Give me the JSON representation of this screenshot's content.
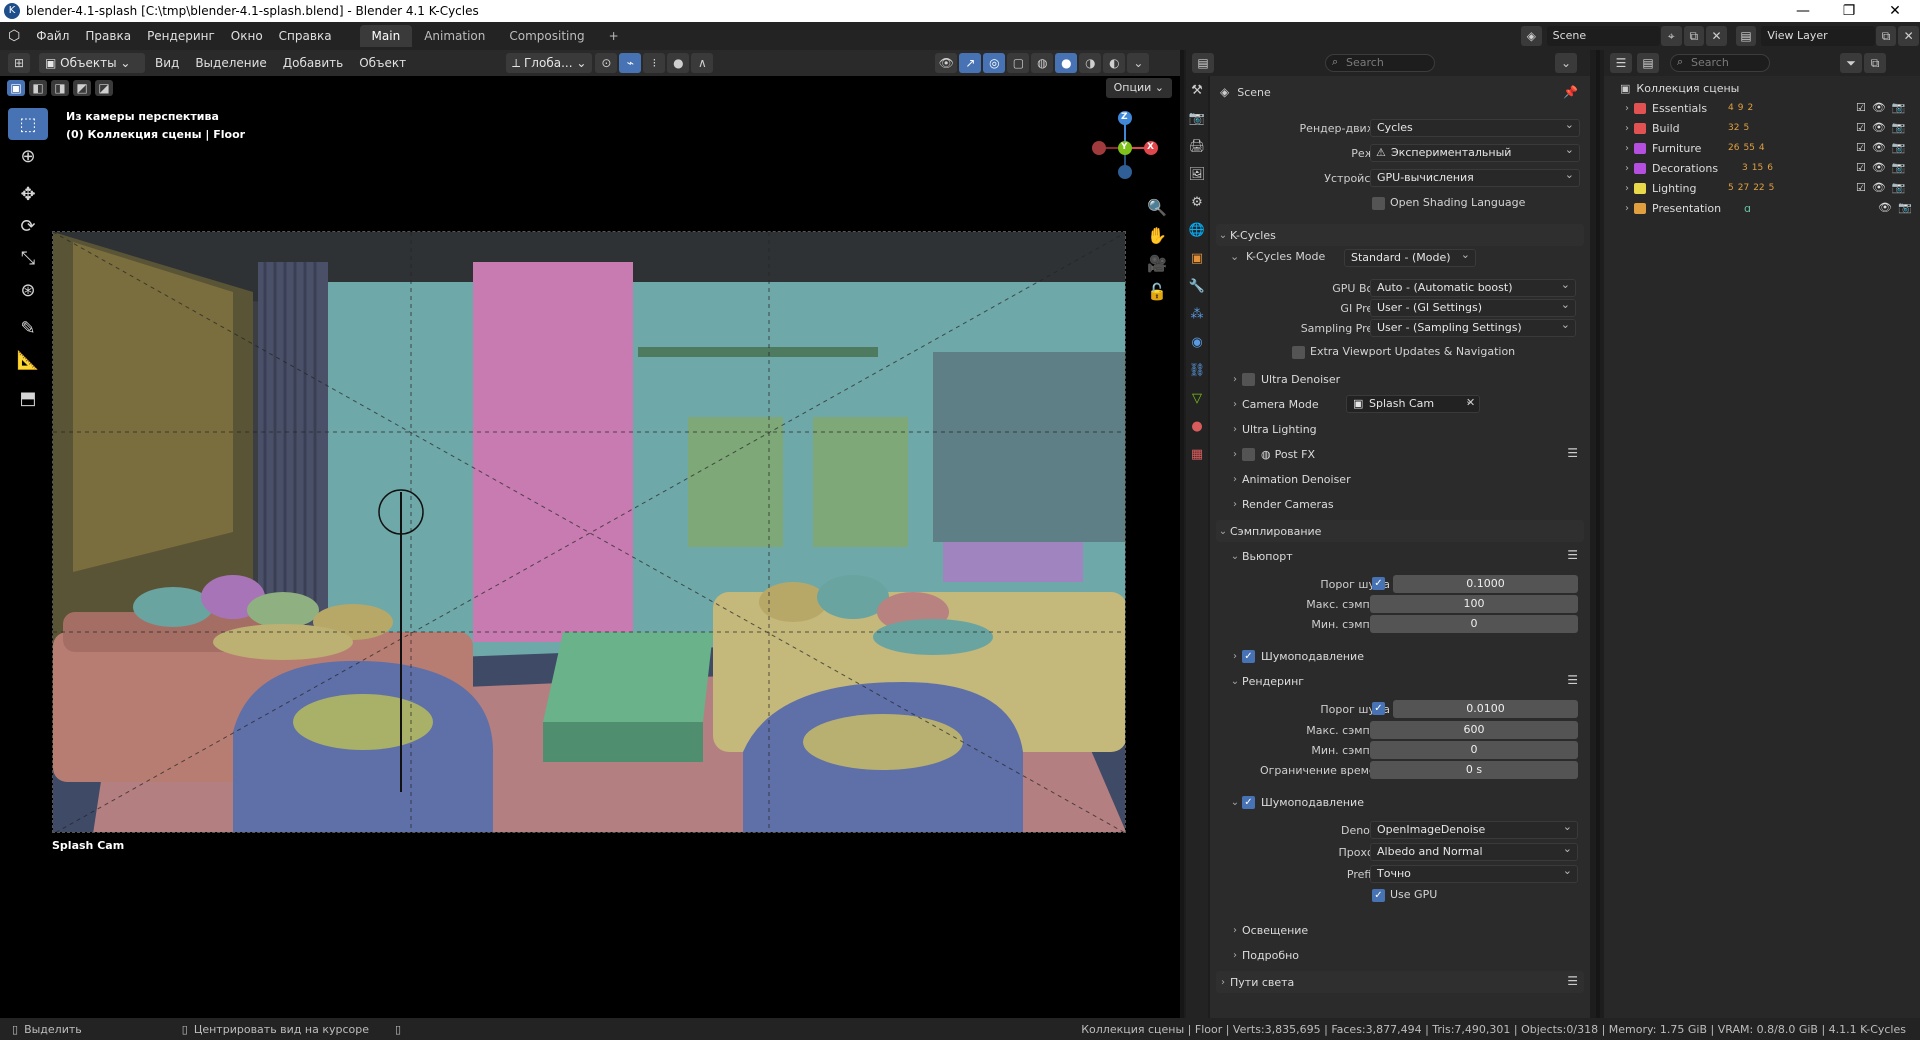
{
  "window": {
    "title": "blender-4.1-splash [C:\\tmp\\blender-4.1-splash.blend] - Blender 4.1 K-Cycles",
    "minimize": "—",
    "maximize": "❐",
    "close": "✕"
  },
  "menu": {
    "items": [
      "Файл",
      "Правка",
      "Рендеринг",
      "Окно",
      "Справка"
    ],
    "workspaces": [
      "Main",
      "Animation",
      "Compositing"
    ],
    "add_workspace": "+"
  },
  "top_right": {
    "scene": "Scene",
    "view_layer": "View Layer"
  },
  "viewport_header": {
    "mode": "Объекты",
    "menus": [
      "Вид",
      "Выделение",
      "Добавить",
      "Объект"
    ],
    "transform_orientation": "Глоба...",
    "options": "Опции"
  },
  "viewport": {
    "info_line1": "Из камеры перспектива",
    "info_line2": "(0) Коллекция сцены | Floor",
    "camera_label": "Splash Cam",
    "gizmo": {
      "x": "X",
      "y": "Y",
      "z": "Z"
    }
  },
  "properties": {
    "search_placeholder": "Search",
    "context": "Scene",
    "render_engine_label": "Рендер-движок",
    "render_engine_value": "Cycles",
    "mode_label": "Режим",
    "mode_value": "Экспериментальный",
    "device_label": "Устройство",
    "device_value": "GPU-вычисления",
    "osl_label": "Open Shading Language",
    "kcycles_panel": "K-Cycles",
    "kcycles_mode_label": "K-Cycles Mode",
    "kcycles_mode_value": "Standard - (Mode)",
    "gpu_boost_label": "GPU Boost",
    "gpu_boost_value": "Auto - (Automatic boost)",
    "gi_preset_label": "GI Preset",
    "gi_preset_value": "User - (GI Settings)",
    "sampling_preset_label": "Sampling Preset",
    "sampling_preset_value": "User - (Sampling Settings)",
    "extra_viewport_label": "Extra Viewport Updates & Navigation",
    "ultra_denoiser": "Ultra Denoiser",
    "camera_mode_label": "Camera Mode",
    "camera_mode_value": "Splash Cam",
    "ultra_lighting": "Ultra Lighting",
    "post_fx": "Post FX",
    "animation_denoiser": "Animation Denoiser",
    "render_cameras": "Render Cameras",
    "sampling_panel": "Сэмплирование",
    "viewport_sub": "Вьюпорт",
    "vp_noise_label": "Порог шума",
    "vp_noise_value": "0.1000",
    "vp_max_label": "Макс. сэмплов",
    "vp_max_value": "100",
    "vp_min_label": "Мин. сэмплов",
    "vp_min_value": "0",
    "vp_denoise": "Шумоподавление",
    "render_sub": "Рендеринг",
    "r_noise_label": "Порог шума",
    "r_noise_value": "0.0100",
    "r_max_label": "Макс. сэмплов",
    "r_max_value": "600",
    "r_min_label": "Мин. сэмплов",
    "r_min_value": "0",
    "r_time_label": "Ограничение времени",
    "r_time_value": "0 s",
    "r_denoise": "Шумоподавление",
    "denoiser_label": "Denoiser",
    "denoiser_value": "OpenImageDenoise",
    "passes_label": "Проходы",
    "passes_value": "Albedo and Normal",
    "prefilter_label": "Prefilter",
    "prefilter_value": "Точно",
    "use_gpu_label": "Use GPU",
    "lighting_sub": "Освещение",
    "advanced_sub": "Подробно",
    "light_paths_panel": "Пути света"
  },
  "outliner": {
    "search_placeholder": "Search",
    "root": "Коллекция сцены",
    "collections": [
      {
        "name": "Essentials",
        "color": "#e25252",
        "stats": [
          "4",
          "9",
          "",
          "2"
        ]
      },
      {
        "name": "Build",
        "color": "#e25252",
        "stats": [
          "",
          "32",
          "5"
        ]
      },
      {
        "name": "Furniture",
        "color": "#b54fe0",
        "stats": [
          "26",
          "55",
          "4"
        ]
      },
      {
        "name": "Decorations",
        "color": "#b54fe0",
        "stats": [
          "3",
          "15",
          "6"
        ]
      },
      {
        "name": "Lighting",
        "color": "#e8d94a",
        "stats": [
          "5",
          "27",
          "22",
          "5"
        ]
      },
      {
        "name": "Presentation",
        "color": "#e0a040",
        "stats": []
      }
    ]
  },
  "statusbar": {
    "select": "Выделить",
    "center_view": "Центрировать вид на курсоре",
    "stats": "Коллекция сцены | Floor | Verts:3,835,695 | Faces:3,877,494 | Tris:7,490,301 | Objects:0/318 | Memory: 1.75 GiB | VRAM: 0.8/8.0 GiB | 4.1.1 K-Cycles"
  },
  "colors": {
    "accent": "#4772b3",
    "axis_x": "#e0474c",
    "axis_y": "#7ec21a",
    "axis_z": "#3f88d8"
  }
}
